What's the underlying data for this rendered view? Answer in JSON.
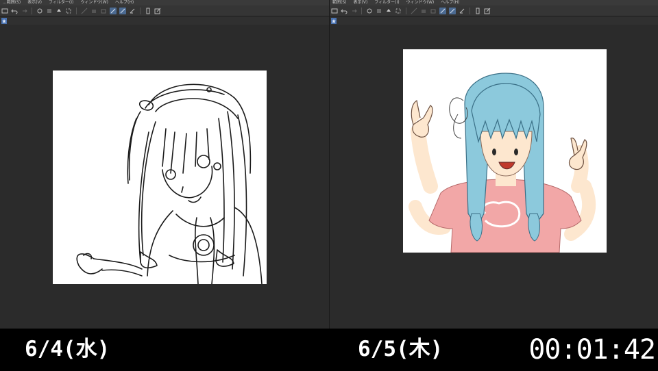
{
  "panes": [
    {
      "menu": [
        "...範囲(S)",
        "表示(V)",
        "フィルター(I)",
        "ウィンドウ(W)",
        "ヘルプ(H)"
      ],
      "date": "6/4(水)"
    },
    {
      "menu": [
        "範囲(S)",
        "表示(V)",
        "フィルター(I)",
        "ウィンドウ(W)",
        "ヘルプ(H)"
      ],
      "date": "6/5(木)"
    }
  ],
  "timer": "00:01:42",
  "colors": {
    "hair": "#8cc9dc",
    "hair_line": "#3a6f86",
    "shirt": "#f2a7a7",
    "skin": "#fde7cf",
    "ui_accent": "#4b6a92"
  }
}
